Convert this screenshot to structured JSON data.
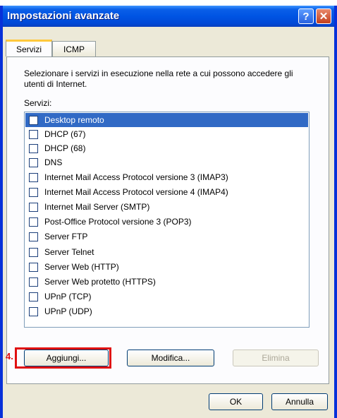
{
  "window": {
    "title": "Impostazioni avanzate",
    "help_label": "?",
    "close_label": "✕"
  },
  "tabs": [
    {
      "label": "Servizi",
      "active": true
    },
    {
      "label": "ICMP",
      "active": false
    }
  ],
  "panel": {
    "description": "Selezionare i servizi in esecuzione nella rete a cui possono accedere gli utenti di Internet.",
    "list_label": "Servizi:",
    "items": [
      {
        "label": "Desktop remoto",
        "checked": false,
        "selected": true
      },
      {
        "label": "DHCP (67)",
        "checked": false
      },
      {
        "label": "DHCP (68)",
        "checked": false
      },
      {
        "label": "DNS",
        "checked": false
      },
      {
        "label": "Internet Mail Access Protocol versione 3 (IMAP3)",
        "checked": false
      },
      {
        "label": "Internet Mail Access Protocol versione 4 (IMAP4)",
        "checked": false
      },
      {
        "label": "Internet Mail Server (SMTP)",
        "checked": false
      },
      {
        "label": "Post-Office Protocol versione 3 (POP3)",
        "checked": false
      },
      {
        "label": "Server FTP",
        "checked": false
      },
      {
        "label": "Server Telnet",
        "checked": false
      },
      {
        "label": "Server Web (HTTP)",
        "checked": false
      },
      {
        "label": "Server Web protetto (HTTPS)",
        "checked": false
      },
      {
        "label": "UPnP (TCP)",
        "checked": false
      },
      {
        "label": "UPnP (UDP)",
        "checked": false
      }
    ]
  },
  "buttons": {
    "add": "Aggiungi...",
    "edit": "Modifica...",
    "delete": "Elimina",
    "ok": "OK",
    "cancel": "Annulla"
  },
  "annotation": {
    "step_label": "4.",
    "color": "#e01010"
  },
  "colors": {
    "titlebar": "#0054e3",
    "selection": "#316ac5",
    "tab_accent": "#ffc83c"
  }
}
